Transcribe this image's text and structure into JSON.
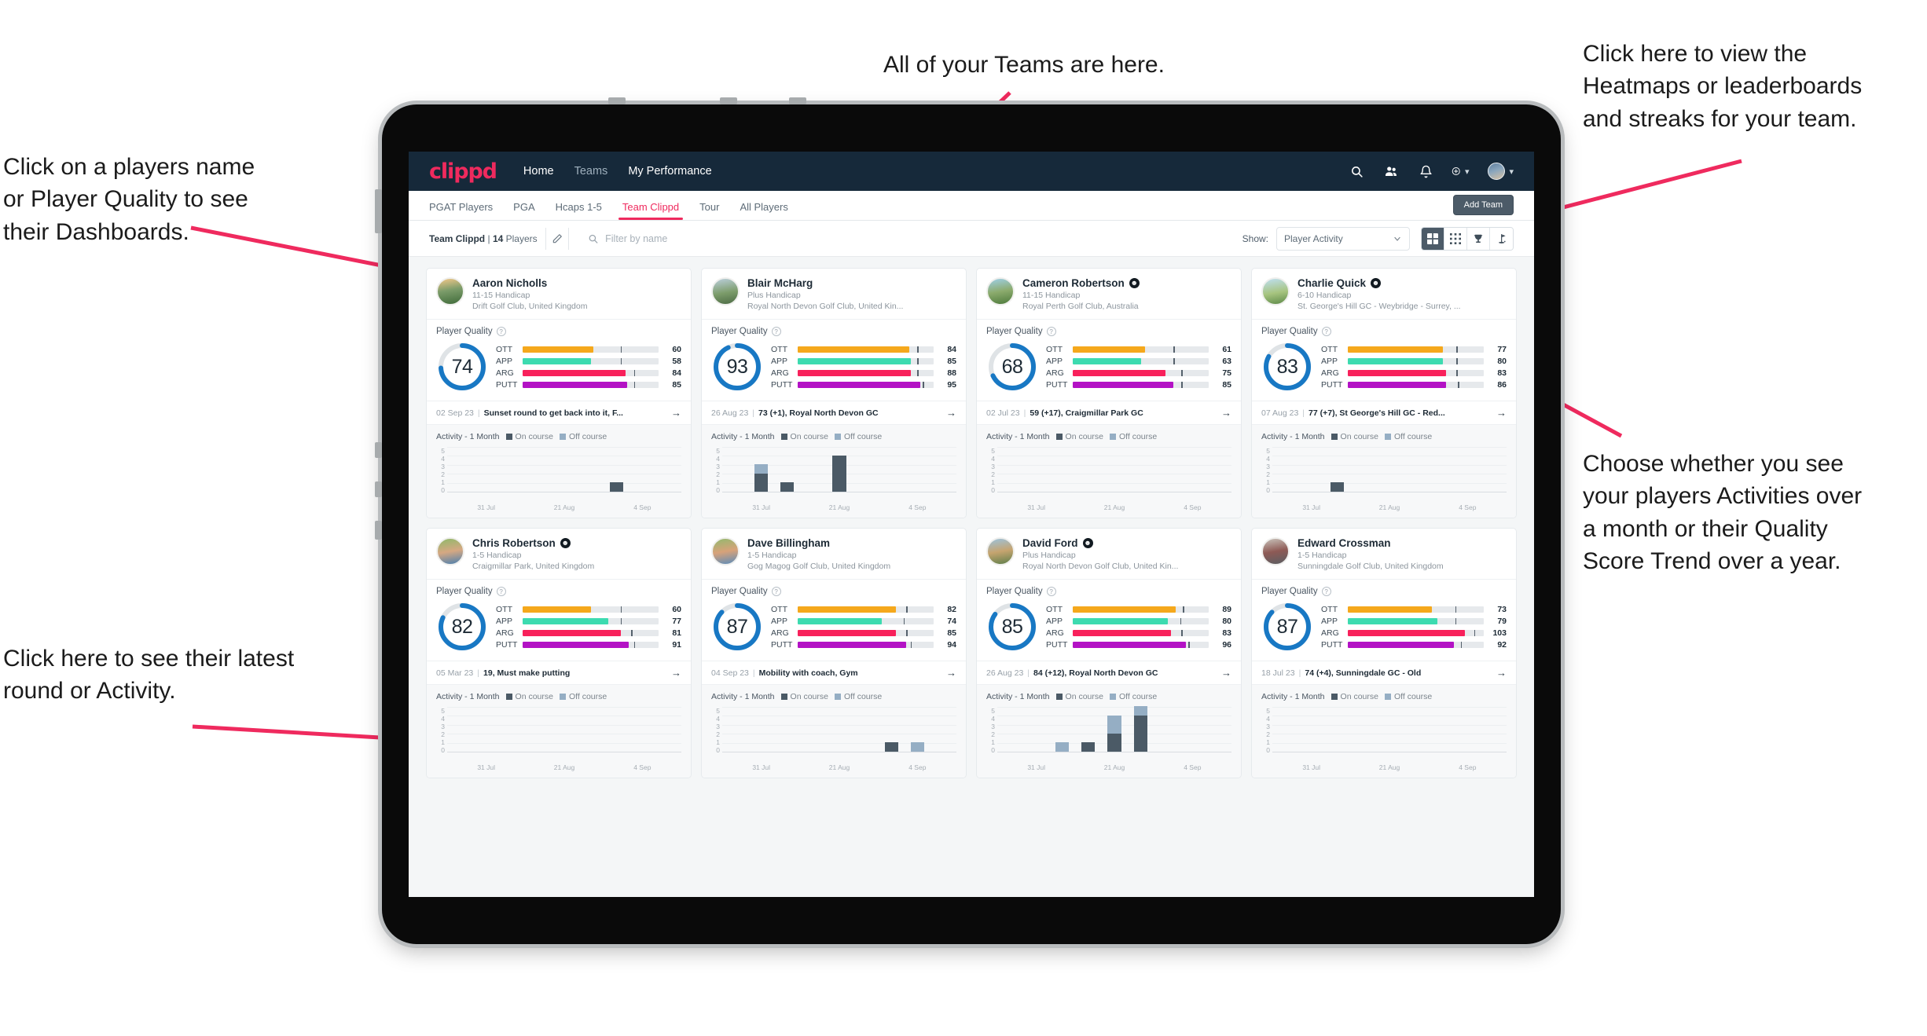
{
  "annotations": [
    {
      "id": "a-teams",
      "text": "All of your Teams are here."
    },
    {
      "id": "a-heatmaps",
      "text": "Click here to view the\nHeatmaps or leaderboards\nand streaks for your team."
    },
    {
      "id": "a-names",
      "text": "Click on a players name\nor Player Quality to see\ntheir Dashboards."
    },
    {
      "id": "a-choose",
      "text": "Choose whether you see\nyour players Activities over\na month or their Quality\nScore Trend over a year."
    },
    {
      "id": "a-latest",
      "text": "Click here to see their latest\nround or Activity."
    }
  ],
  "colors": {
    "brand": "#ef2a5e",
    "navbar": "#16293a",
    "ott": "#f5a81c",
    "app": "#3ddbb0",
    "arg": "#f8215b",
    "putt": "#b312c5",
    "ring": "#1878c4",
    "on_course": "#4b5a66",
    "off_course": "#95aec4"
  },
  "navbar": {
    "logo": "clippd",
    "links": [
      {
        "label": "Home",
        "dim": false
      },
      {
        "label": "Teams",
        "dim": true
      },
      {
        "label": "My Performance",
        "dim": false
      }
    ],
    "icons": [
      {
        "name": "search-icon"
      },
      {
        "name": "people-icon"
      },
      {
        "name": "bell-icon"
      },
      {
        "name": "plus-circle-icon"
      }
    ]
  },
  "tabs": [
    {
      "label": "PGAT Players",
      "active": false
    },
    {
      "label": "PGA",
      "active": false
    },
    {
      "label": "Hcaps 1-5",
      "active": false
    },
    {
      "label": "Team Clippd",
      "active": true
    },
    {
      "label": "Tour",
      "active": false
    },
    {
      "label": "All Players",
      "active": false
    }
  ],
  "add_team_label": "Add Team",
  "toolbar": {
    "team_name": "Team Clippd",
    "separator": "|",
    "player_count": "14",
    "players_word": "Players",
    "edit_icon": "pencil-icon",
    "search_placeholder": "Filter by name",
    "search_value": "",
    "show_label": "Show:",
    "show_value": "Player Activity",
    "show_options": [
      "Player Activity",
      "Quality Score Trend"
    ],
    "views": [
      {
        "name": "grid-large-view",
        "active": true
      },
      {
        "name": "grid-small-view",
        "active": false
      },
      {
        "name": "trophy-view",
        "active": false
      },
      {
        "name": "flag-view",
        "active": false
      }
    ]
  },
  "card_labels": {
    "player_quality": "Player Quality",
    "activity": "Activity - 1 Month",
    "on_course": "On course",
    "off_course": "Off course",
    "metrics": [
      "OTT",
      "APP",
      "ARG",
      "PUTT"
    ]
  },
  "chart_data": {
    "type": "bar",
    "title": "Activity - 1 Month (stacked, per player card)",
    "ylabel": "",
    "xlabel": "",
    "ylim": [
      0,
      5
    ],
    "yticks": [
      5,
      4,
      3,
      2,
      1,
      0
    ],
    "xticks": [
      "31 Jul",
      "21 Aug",
      "4 Sep"
    ],
    "slots": 9,
    "series": [
      {
        "name": "On course",
        "color": "#4b5a66"
      },
      {
        "name": "Off course",
        "color": "#95aec4"
      }
    ],
    "per_player": {
      "Aaron Nicholls": {
        "on": [
          0,
          0,
          0,
          0,
          0,
          0,
          1,
          0,
          0
        ],
        "off": [
          0,
          0,
          0,
          0,
          0,
          0,
          0,
          0,
          0
        ]
      },
      "Blair McHarg": {
        "on": [
          0,
          2,
          1,
          0,
          4,
          0,
          0,
          0,
          0
        ],
        "off": [
          0,
          1,
          0,
          0,
          0,
          0,
          0,
          0,
          0
        ]
      },
      "Cameron Robertson": {
        "on": [
          0,
          0,
          0,
          0,
          0,
          0,
          0,
          0,
          0
        ],
        "off": [
          0,
          0,
          0,
          0,
          0,
          0,
          0,
          0,
          0
        ]
      },
      "Charlie Quick": {
        "on": [
          0,
          0,
          1,
          0,
          0,
          0,
          0,
          0,
          0
        ],
        "off": [
          0,
          0,
          0,
          0,
          0,
          0,
          0,
          0,
          0
        ]
      },
      "Chris Robertson": {
        "on": [
          0,
          0,
          0,
          0,
          0,
          0,
          0,
          0,
          0
        ],
        "off": [
          0,
          0,
          0,
          0,
          0,
          0,
          0,
          0,
          0
        ]
      },
      "Dave Billingham": {
        "on": [
          0,
          0,
          0,
          0,
          0,
          0,
          1,
          0,
          0
        ],
        "off": [
          0,
          0,
          0,
          0,
          0,
          0,
          0,
          1,
          0
        ]
      },
      "David Ford": {
        "on": [
          0,
          0,
          0,
          1,
          2,
          4,
          0,
          0,
          0
        ],
        "off": [
          0,
          0,
          1,
          0,
          2,
          1,
          0,
          0,
          0
        ]
      },
      "Edward Crossman": {
        "on": [
          0,
          0,
          0,
          0,
          0,
          0,
          0,
          0,
          0
        ],
        "off": [
          0,
          0,
          0,
          0,
          0,
          0,
          0,
          0,
          0
        ]
      }
    }
  },
  "players": [
    {
      "name": "Aaron Nicholls",
      "verified": false,
      "handicap": "11-15 Handicap",
      "club": "Drift Golf Club, United Kingdom",
      "quality": 74,
      "metrics": [
        {
          "label": "OTT",
          "value": 60,
          "fill": 52,
          "tick": 72
        },
        {
          "label": "APP",
          "value": 58,
          "fill": 50,
          "tick": 72
        },
        {
          "label": "ARG",
          "value": 84,
          "fill": 76,
          "tick": 82
        },
        {
          "label": "PUTT",
          "value": 85,
          "fill": 77,
          "tick": 82
        }
      ],
      "round_date": "02 Sep 23",
      "round_text": "Sunset round to get back into it, F...",
      "activity_on": [
        0,
        0,
        0,
        0,
        0,
        0,
        1,
        0,
        0
      ],
      "activity_off": [
        0,
        0,
        0,
        0,
        0,
        0,
        0,
        0,
        0
      ]
    },
    {
      "name": "Blair McHarg",
      "verified": false,
      "handicap": "Plus Handicap",
      "club": "Royal North Devon Golf Club, United Kin...",
      "quality": 93,
      "metrics": [
        {
          "label": "OTT",
          "value": 84,
          "fill": 82,
          "tick": 88
        },
        {
          "label": "APP",
          "value": 85,
          "fill": 83,
          "tick": 88
        },
        {
          "label": "ARG",
          "value": 88,
          "fill": 83,
          "tick": 88
        },
        {
          "label": "PUTT",
          "value": 95,
          "fill": 90,
          "tick": 92
        }
      ],
      "round_date": "26 Aug 23",
      "round_text": "73 (+1), Royal North Devon GC",
      "activity_on": [
        0,
        2,
        1,
        0,
        4,
        0,
        0,
        0,
        0
      ],
      "activity_off": [
        0,
        1,
        0,
        0,
        0,
        0,
        0,
        0,
        0
      ]
    },
    {
      "name": "Cameron Robertson",
      "verified": true,
      "handicap": "11-15 Handicap",
      "club": "Royal Perth Golf Club, Australia",
      "quality": 68,
      "metrics": [
        {
          "label": "OTT",
          "value": 61,
          "fill": 53,
          "tick": 74
        },
        {
          "label": "APP",
          "value": 63,
          "fill": 50,
          "tick": 74
        },
        {
          "label": "ARG",
          "value": 75,
          "fill": 68,
          "tick": 80
        },
        {
          "label": "PUTT",
          "value": 85,
          "fill": 74,
          "tick": 80
        }
      ],
      "round_date": "02 Jul 23",
      "round_text": "59 (+17), Craigmillar Park GC",
      "activity_on": [
        0,
        0,
        0,
        0,
        0,
        0,
        0,
        0,
        0
      ],
      "activity_off": [
        0,
        0,
        0,
        0,
        0,
        0,
        0,
        0,
        0
      ]
    },
    {
      "name": "Charlie Quick",
      "verified": true,
      "handicap": "6-10 Handicap",
      "club": "St. George's Hill GC - Weybridge - Surrey, ...",
      "quality": 83,
      "metrics": [
        {
          "label": "OTT",
          "value": 77,
          "fill": 70,
          "tick": 80
        },
        {
          "label": "APP",
          "value": 80,
          "fill": 70,
          "tick": 80
        },
        {
          "label": "ARG",
          "value": 83,
          "fill": 72,
          "tick": 80
        },
        {
          "label": "PUTT",
          "value": 86,
          "fill": 72,
          "tick": 81
        }
      ],
      "round_date": "07 Aug 23",
      "round_text": "77 (+7), St George's Hill GC - Red...",
      "activity_on": [
        0,
        0,
        1,
        0,
        0,
        0,
        0,
        0,
        0
      ],
      "activity_off": [
        0,
        0,
        0,
        0,
        0,
        0,
        0,
        0,
        0
      ]
    },
    {
      "name": "Chris Robertson",
      "verified": true,
      "handicap": "1-5 Handicap",
      "club": "Craigmillar Park, United Kingdom",
      "quality": 82,
      "metrics": [
        {
          "label": "OTT",
          "value": 60,
          "fill": 50,
          "tick": 72
        },
        {
          "label": "APP",
          "value": 77,
          "fill": 63,
          "tick": 72
        },
        {
          "label": "ARG",
          "value": 81,
          "fill": 72,
          "tick": 80
        },
        {
          "label": "PUTT",
          "value": 91,
          "fill": 78,
          "tick": 82
        }
      ],
      "round_date": "05 Mar 23",
      "round_text": "19, Must make putting",
      "activity_on": [
        0,
        0,
        0,
        0,
        0,
        0,
        0,
        0,
        0
      ],
      "activity_off": [
        0,
        0,
        0,
        0,
        0,
        0,
        0,
        0,
        0
      ]
    },
    {
      "name": "Dave Billingham",
      "verified": false,
      "handicap": "1-5 Handicap",
      "club": "Gog Magog Golf Club, United Kingdom",
      "quality": 87,
      "metrics": [
        {
          "label": "OTT",
          "value": 82,
          "fill": 72,
          "tick": 80
        },
        {
          "label": "APP",
          "value": 74,
          "fill": 62,
          "tick": 78
        },
        {
          "label": "ARG",
          "value": 85,
          "fill": 72,
          "tick": 80
        },
        {
          "label": "PUTT",
          "value": 94,
          "fill": 80,
          "tick": 83
        }
      ],
      "round_date": "04 Sep 23",
      "round_text": "Mobility with coach, Gym",
      "activity_on": [
        0,
        0,
        0,
        0,
        0,
        0,
        1,
        0,
        0
      ],
      "activity_off": [
        0,
        0,
        0,
        0,
        0,
        0,
        0,
        1,
        0
      ]
    },
    {
      "name": "David Ford",
      "verified": true,
      "handicap": "Plus Handicap",
      "club": "Royal North Devon Golf Club, United Kin...",
      "quality": 85,
      "metrics": [
        {
          "label": "OTT",
          "value": 89,
          "fill": 76,
          "tick": 81
        },
        {
          "label": "APP",
          "value": 80,
          "fill": 70,
          "tick": 79
        },
        {
          "label": "ARG",
          "value": 83,
          "fill": 72,
          "tick": 80
        },
        {
          "label": "PUTT",
          "value": 96,
          "fill": 83,
          "tick": 85
        }
      ],
      "round_date": "26 Aug 23",
      "round_text": "84 (+12), Royal North Devon GC",
      "activity_on": [
        0,
        0,
        0,
        1,
        2,
        4,
        0,
        0,
        0
      ],
      "activity_off": [
        0,
        0,
        1,
        0,
        2,
        1,
        0,
        0,
        0
      ]
    },
    {
      "name": "Edward Crossman",
      "verified": false,
      "handicap": "1-5 Handicap",
      "club": "Sunningdale Golf Club, United Kingdom",
      "quality": 87,
      "metrics": [
        {
          "label": "OTT",
          "value": 73,
          "fill": 62,
          "tick": 79
        },
        {
          "label": "APP",
          "value": 79,
          "fill": 66,
          "tick": 79
        },
        {
          "label": "ARG",
          "value": 103,
          "fill": 86,
          "tick": 93
        },
        {
          "label": "PUTT",
          "value": 92,
          "fill": 78,
          "tick": 83
        }
      ],
      "round_date": "18 Jul 23",
      "round_text": "74 (+4), Sunningdale GC - Old",
      "activity_on": [
        0,
        0,
        0,
        0,
        0,
        0,
        0,
        0,
        0
      ],
      "activity_off": [
        0,
        0,
        0,
        0,
        0,
        0,
        0,
        0,
        0
      ]
    }
  ]
}
